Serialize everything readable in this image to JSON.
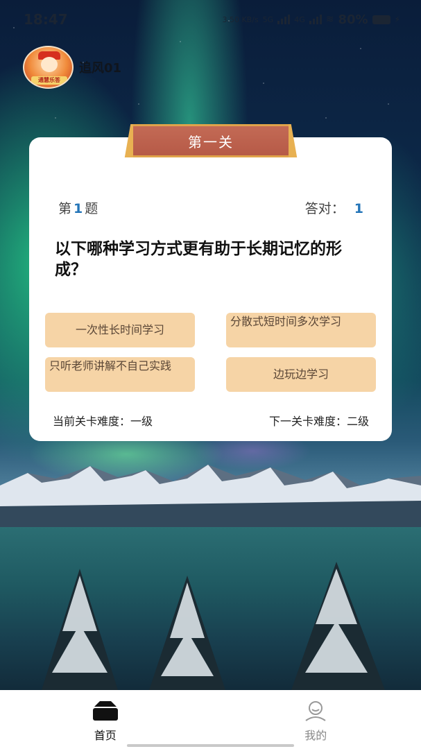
{
  "status_bar": {
    "time": "18:47",
    "network_speed": "3.50 KB/s",
    "signal_1": "5G",
    "signal_2": "4G",
    "battery": "80%"
  },
  "user": {
    "name": "追风01",
    "avatar_text": "通慧乐答"
  },
  "quiz": {
    "level_title": "第一关",
    "question_prefix": "第",
    "question_number": "1",
    "question_suffix": "题",
    "correct_label": "答对：",
    "correct_count": "1",
    "question_text": "以下哪种学习方式更有助于长期记忆的形成？",
    "options": [
      "一次性长时间学习",
      "分散式短时间多次学习",
      "只听老师讲解不自己实践",
      "边玩边学习"
    ],
    "current_difficulty": "当前关卡难度：一级",
    "next_difficulty": "下一关卡难度：二级"
  },
  "nav": {
    "home_label": "首页",
    "mine_label": "我的"
  },
  "colors": {
    "option_bg": "#f6d4a6",
    "accent_blue": "#2475b8",
    "banner": "#b65a47"
  }
}
